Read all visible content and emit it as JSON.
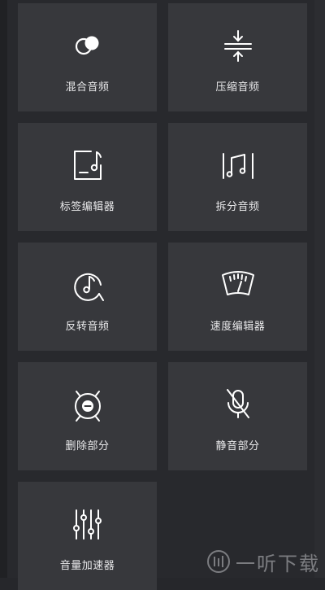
{
  "tools": [
    {
      "label": "混合音频",
      "icon": "mix-audio-icon"
    },
    {
      "label": "压缩音频",
      "icon": "compress-audio-icon"
    },
    {
      "label": "标签编辑器",
      "icon": "tag-editor-icon"
    },
    {
      "label": "拆分音频",
      "icon": "split-audio-icon"
    },
    {
      "label": "反转音频",
      "icon": "reverse-audio-icon"
    },
    {
      "label": "速度编辑器",
      "icon": "speed-editor-icon"
    },
    {
      "label": "删除部分",
      "icon": "delete-part-icon"
    },
    {
      "label": "静音部分",
      "icon": "mute-part-icon"
    },
    {
      "label": "音量加速器",
      "icon": "volume-booster-icon"
    }
  ],
  "watermark": {
    "text": "一听下载"
  },
  "colors": {
    "background": "#28292d",
    "tile": "#37383c",
    "text": "#e8e8ea"
  }
}
